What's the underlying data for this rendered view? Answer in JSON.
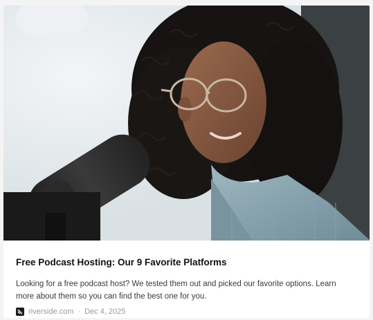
{
  "card": {
    "image_alt_icon": "podcast-host-photo",
    "title": "Free Podcast Hosting: Our 9 Favorite Platforms",
    "description": "Looking for a free podcast host? We tested them out and picked our favorite options. Learn more about them so you can find the best one for you.",
    "source": "riverside.com",
    "separator": "·",
    "date": "Dec 4, 2025",
    "source_icon": "riverside-logo-icon"
  },
  "colors": {
    "title": "#111111",
    "description": "#3a3a3a",
    "meta": "#9a9a9a"
  }
}
